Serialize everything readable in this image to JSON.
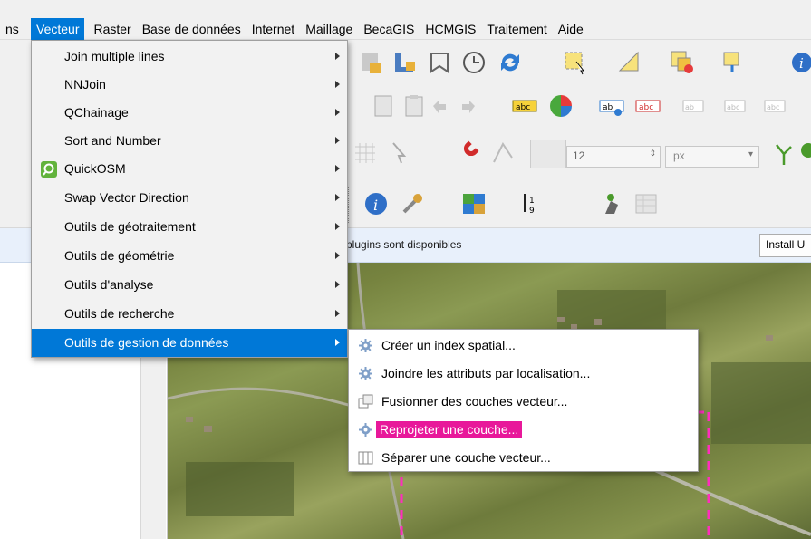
{
  "menubar": {
    "items": [
      {
        "id": "ns",
        "label": "ns"
      },
      {
        "id": "vecteur",
        "label": "Vecteur"
      },
      {
        "id": "raster",
        "label": "Raster"
      },
      {
        "id": "base",
        "label": "Base de données"
      },
      {
        "id": "internet",
        "label": "Internet"
      },
      {
        "id": "maillage",
        "label": "Maillage"
      },
      {
        "id": "becagis",
        "label": "BecaGIS"
      },
      {
        "id": "hcmgis",
        "label": "HCMGIS"
      },
      {
        "id": "traitement",
        "label": "Traitement"
      },
      {
        "id": "aide",
        "label": "Aide"
      }
    ]
  },
  "toolbar": {
    "font_size_value": "12",
    "unit_value": "px"
  },
  "notification": {
    "message": "plugins sont disponibles",
    "install_label": "Install U"
  },
  "vector_menu": {
    "items": [
      {
        "label": "Join multiple lines"
      },
      {
        "label": "NNJoin"
      },
      {
        "label": "QChainage"
      },
      {
        "label": "Sort and Number"
      },
      {
        "label": "QuickOSM"
      },
      {
        "label": "Swap Vector Direction"
      },
      {
        "label": "Outils de géotraitement"
      },
      {
        "label": "Outils de géométrie"
      },
      {
        "label": "Outils d'analyse"
      },
      {
        "label": "Outils de recherche"
      },
      {
        "label": "Outils de gestion de données"
      }
    ]
  },
  "submenu": {
    "items": [
      {
        "label": "Créer un index spatial..."
      },
      {
        "label": "Joindre les attributs par localisation..."
      },
      {
        "label": "Fusionner des couches vecteur..."
      },
      {
        "label": "Reprojeter une couche..."
      },
      {
        "label": "Séparer une couche vecteur..."
      }
    ]
  },
  "colors": {
    "menu_highlight": "#0078d7",
    "annotation_magenta": "#e8189a",
    "map_border_dash": "#ff2dbd"
  }
}
